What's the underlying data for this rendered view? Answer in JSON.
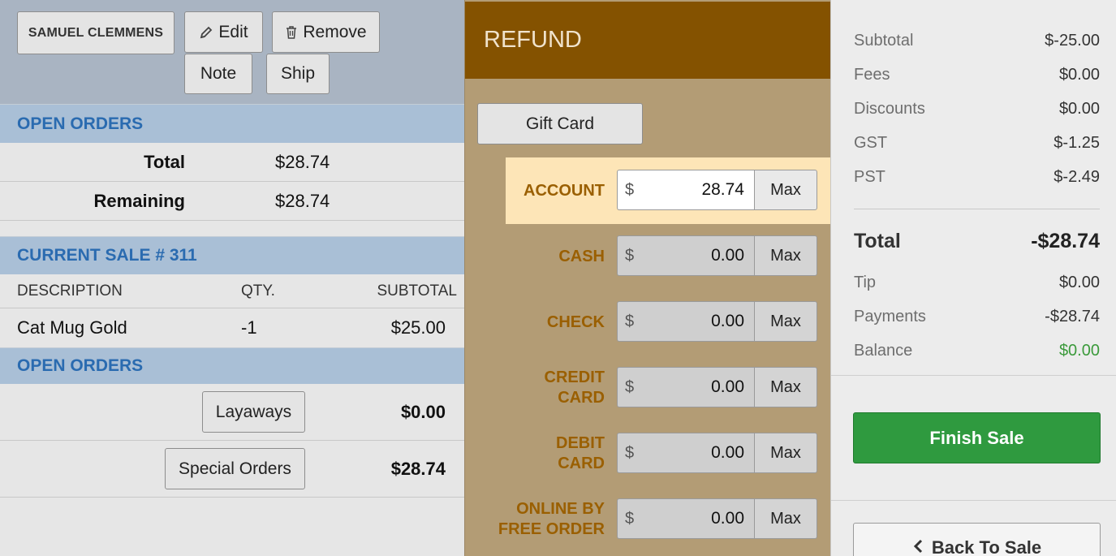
{
  "customer": {
    "name": "SAMUEL CLEMMENS",
    "edit_label": "Edit",
    "remove_label": "Remove",
    "note_label": "Note",
    "ship_label": "Ship"
  },
  "open_orders_top": {
    "title": "OPEN ORDERS",
    "total_label": "Total",
    "total_value": "$28.74",
    "remaining_label": "Remaining",
    "remaining_value": "$28.74"
  },
  "current_sale": {
    "title": "CURRENT SALE # 311",
    "columns": [
      "DESCRIPTION",
      "QTY.",
      "SUBTOTAL"
    ],
    "items": [
      {
        "description": "Cat Mug Gold",
        "qty": "-1",
        "subtotal": "$25.00"
      }
    ]
  },
  "open_orders_bottom": {
    "title": "OPEN ORDERS",
    "layaways_label": "Layaways",
    "layaways_value": "$0.00",
    "special_orders_label": "Special Orders",
    "special_orders_value": "$28.74"
  },
  "refund": {
    "title": "REFUND",
    "gift_card_label": "Gift Card",
    "currency_symbol": "$",
    "max_label": "Max",
    "methods": [
      {
        "label": "ACCOUNT",
        "amount": "28.74",
        "active": true
      },
      {
        "label": "CASH",
        "amount": "0.00"
      },
      {
        "label": "CHECK",
        "amount": "0.00"
      },
      {
        "label": "CREDIT CARD",
        "amount": "0.00"
      },
      {
        "label": "DEBIT CARD",
        "amount": "0.00"
      },
      {
        "label": "ONLINE BY FREE ORDER",
        "amount": "0.00"
      }
    ]
  },
  "summary": {
    "subtotal_label": "Subtotal",
    "subtotal": "$-25.00",
    "fees_label": "Fees",
    "fees": "$0.00",
    "discounts_label": "Discounts",
    "discounts": "$0.00",
    "gst_label": "GST",
    "gst": "$-1.25",
    "pst_label": "PST",
    "pst": "$-2.49",
    "total_label": "Total",
    "total": "-$28.74",
    "tip_label": "Tip",
    "tip": "$0.00",
    "payments_label": "Payments",
    "payments": "-$28.74",
    "balance_label": "Balance",
    "balance": "$0.00",
    "balance_color": "#3b9a3b"
  },
  "actions": {
    "finish_label": "Finish Sale",
    "back_label": "Back To Sale"
  },
  "colors": {
    "refund_header": "#845200",
    "refund_panel": "#b39c75",
    "section_header": "#a9bfd6",
    "finish_button": "#2f9a3f"
  }
}
